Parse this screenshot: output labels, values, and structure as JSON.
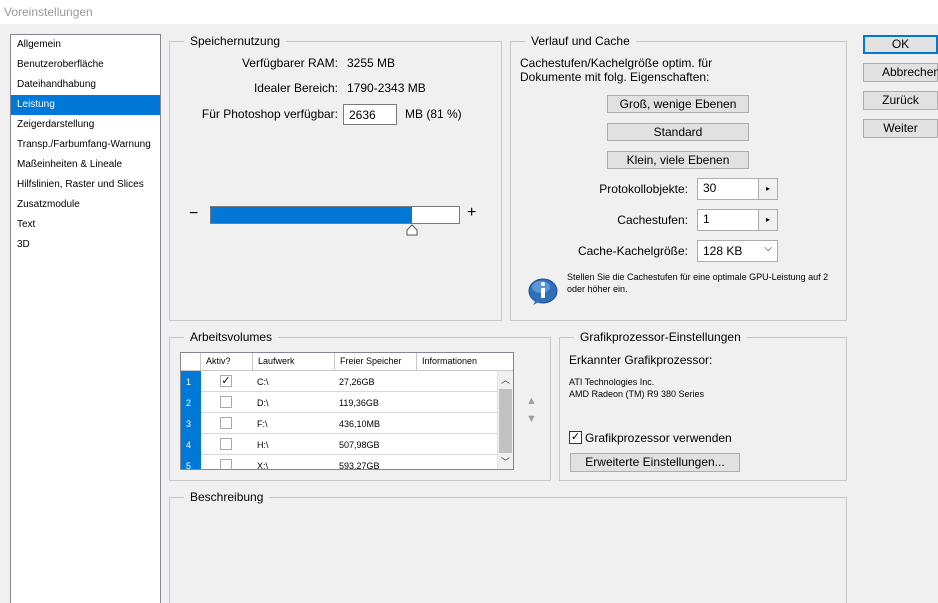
{
  "window": {
    "title": "Voreinstellungen"
  },
  "nav": {
    "items": [
      {
        "label": "Allgemein"
      },
      {
        "label": "Benutzeroberfläche"
      },
      {
        "label": "Dateihandhabung"
      },
      {
        "label": "Leistung",
        "selected": true
      },
      {
        "label": "Zeigerdarstellung"
      },
      {
        "label": "Transp./Farbumfang-Warnung"
      },
      {
        "label": "Maßeinheiten & Lineale"
      },
      {
        "label": "Hilfslinien, Raster und Slices"
      },
      {
        "label": "Zusatzmodule"
      },
      {
        "label": "Text"
      },
      {
        "label": "3D"
      }
    ]
  },
  "memory": {
    "title": "Speichernutzung",
    "available_label": "Verfügbarer RAM:",
    "available_value": "3255 MB",
    "ideal_label": "Idealer Bereich:",
    "ideal_value": "1790-2343 MB",
    "photoshop_label": "Für Photoshop verfügbar:",
    "photoshop_value": "2636",
    "photoshop_unit": "MB (81 %)",
    "minus": "−",
    "plus": "+",
    "slider_fraction": 0.81
  },
  "cache": {
    "title": "Verlauf und Cache",
    "description": "Cachestufen/Kachelgröße optim. für Dokumente mit folg. Eigenschaften:",
    "btn_large": "Groß, wenige Ebenen",
    "btn_default": "Standard",
    "btn_small": "Klein, viele Ebenen",
    "history_label": "Protokollobjekte:",
    "history_value": "30",
    "levels_label": "Cachestufen:",
    "levels_value": "1",
    "tile_label": "Cache-Kachelgröße:",
    "tile_value": "128 KB",
    "info_text": "Stellen Sie die Cachestufen für eine optimale GPU-Leistung auf 2 oder höher ein."
  },
  "scratch": {
    "title": "Arbeitsvolumes",
    "columns": [
      "Aktiv?",
      "Laufwerk",
      "Freier Speicher",
      "Informationen"
    ],
    "rows": [
      {
        "num": "1",
        "active": true,
        "drive": "C:\\",
        "free": "27,26GB",
        "info": ""
      },
      {
        "num": "2",
        "active": false,
        "drive": "D:\\",
        "free": "119,36GB",
        "info": ""
      },
      {
        "num": "3",
        "active": false,
        "drive": "F:\\",
        "free": "436,10MB",
        "info": ""
      },
      {
        "num": "4",
        "active": false,
        "drive": "H:\\",
        "free": "507,98GB",
        "info": ""
      },
      {
        "num": "5",
        "active": false,
        "drive": "X:\\",
        "free": "593,27GB",
        "info": ""
      }
    ]
  },
  "gpu": {
    "title": "Grafikprozessor-Einstellungen",
    "detected_label": "Erkannter Grafikprozessor:",
    "vendor": "ATI Technologies Inc.",
    "model": "AMD Radeon (TM) R9 380 Series",
    "use_label": "Grafikprozessor verwenden",
    "use_checked": true,
    "advanced_label": "Erweiterte Einstellungen..."
  },
  "description": {
    "title": "Beschreibung"
  },
  "actions": {
    "ok": "OK",
    "cancel": "Abbrechen",
    "back": "Zurück",
    "next": "Weiter"
  },
  "colors": {
    "accent": "#0078d7"
  }
}
